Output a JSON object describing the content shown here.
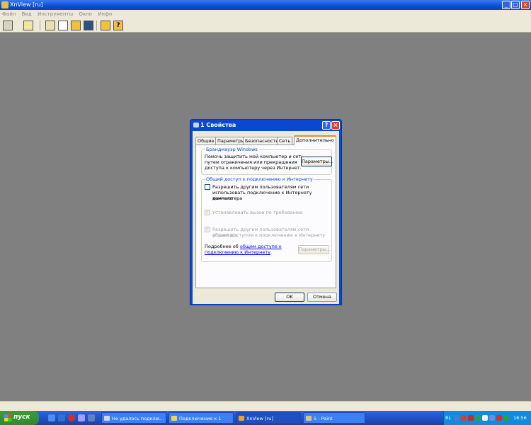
{
  "app": {
    "title": "XnView [ru]",
    "menu": [
      "Файл",
      "Вид",
      "Инструменты",
      "Окно",
      "Инфо"
    ],
    "window_buttons": [
      "minimize",
      "maximize",
      "close"
    ]
  },
  "toolbar": {
    "icons": [
      "browser-icon",
      "open-icon",
      "acquire-icon",
      "scan-icon",
      "capture-icon",
      "slideshow-icon",
      "settings-icon",
      "help-icon"
    ]
  },
  "dialog": {
    "title": "1 Свойства",
    "tabs": [
      "Общие",
      "Параметры",
      "Безопасность",
      "Сеть",
      "Дополнительно"
    ],
    "active_tab": "Дополнительно",
    "firewall": {
      "label": "Брандмауэр Windows",
      "line1": "Помочь защитить мой компьютер и сеть",
      "line2": "путем ограничения или прекращения",
      "line3": "доступа к компьютеру через Интернет.",
      "button": "Параметры..."
    },
    "ics": {
      "label": "Общий доступ к подключению к Интернету",
      "allow_line1": "Разрешить другим пользователям сети",
      "allow_line2": "использовать подключение к Интернету данного",
      "allow_line3": "компьютера",
      "dial_on_demand": "Устанавливать вызов по требованию",
      "allow_control_line1": "Разрешить другим пользователям сети управлять",
      "allow_control_line2": "общим доступом к подключению к Интернету",
      "more_prefix": "Подробнее об ",
      "more_link1": "общем доступе к",
      "more_link2": "подключению к Интернету",
      "more_suffix": ".",
      "button": "Параметры..."
    },
    "ok": "OK",
    "cancel": "Отмена"
  },
  "taskbar": {
    "start": "пуск",
    "tasks": [
      "Не удалось подклю...",
      "Подключение к 1",
      "XnView [ru]",
      "5 - Paint"
    ],
    "tray_lang": "RL",
    "clock": "16:56"
  }
}
